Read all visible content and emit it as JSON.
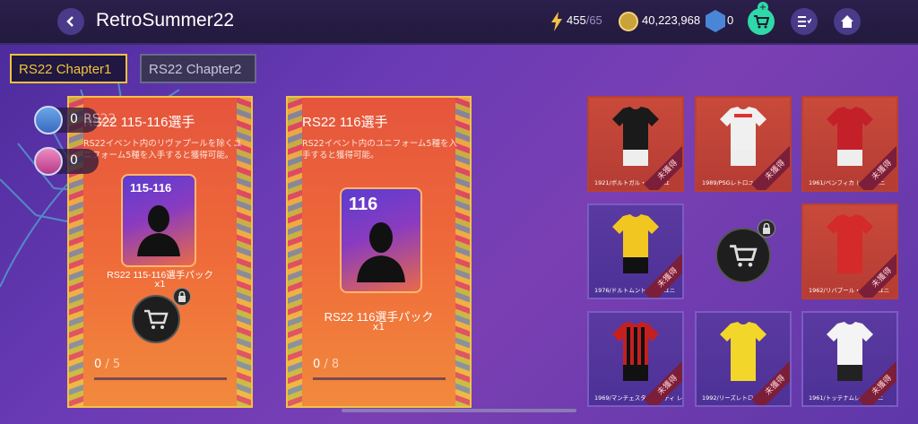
{
  "header": {
    "title": "RetroSummer22",
    "energy": "455",
    "energy_max": "/65",
    "coins": "40,223,968",
    "fc_points": "0"
  },
  "tabs": [
    {
      "label": "RS22 Chapter1"
    },
    {
      "label": "RS22 Chapter2"
    }
  ],
  "side_counters": [
    {
      "value": "0",
      "ghost": "RS22"
    },
    {
      "value": "0"
    }
  ],
  "packs": [
    {
      "title": "RS22 115-116選手",
      "desc": "RS22イベント内のリヴァプールを除くユニフォーム5種を入手すると獲得可能。",
      "card_num": "115-116",
      "name": "RS22 115-116選手パック",
      "count": "x1",
      "progress": "0",
      "progress_max": "/ 5"
    },
    {
      "title": "RS22 116選手",
      "desc": "RS22イベント内のユニフォーム5種を入手すると獲得可能。",
      "card_num": "116",
      "name": "RS22 116選手パック",
      "count": "x1",
      "progress": "0",
      "progress_max": "/ 8"
    }
  ],
  "kits": [
    {
      "name": "1921/ボルトガル・レトロユ",
      "ribbon": "未獲得"
    },
    {
      "name": "1989/PSGレトロユニフ",
      "ribbon": "未獲得"
    },
    {
      "name": "1961/ベンフィカ レトロユニ",
      "ribbon": "未獲得"
    },
    {
      "name": "1976/ドルトムントレトロユニ",
      "ribbon": "未獲得"
    },
    {
      "name": "1962/リバプール・レトロユニ",
      "ribbon": "未獲得"
    },
    {
      "name": "1969/マンチェスター・シティ レトロ",
      "ribbon": "未獲得"
    },
    {
      "name": "1992/リーズレトロユニ",
      "ribbon": "未獲得"
    },
    {
      "name": "1961/トッテナムレトロユニ",
      "ribbon": "未獲得"
    }
  ],
  "colors": {
    "accent": "#f0c23b",
    "card_bg": "#e5553c",
    "bg": "#6a3bb5"
  }
}
